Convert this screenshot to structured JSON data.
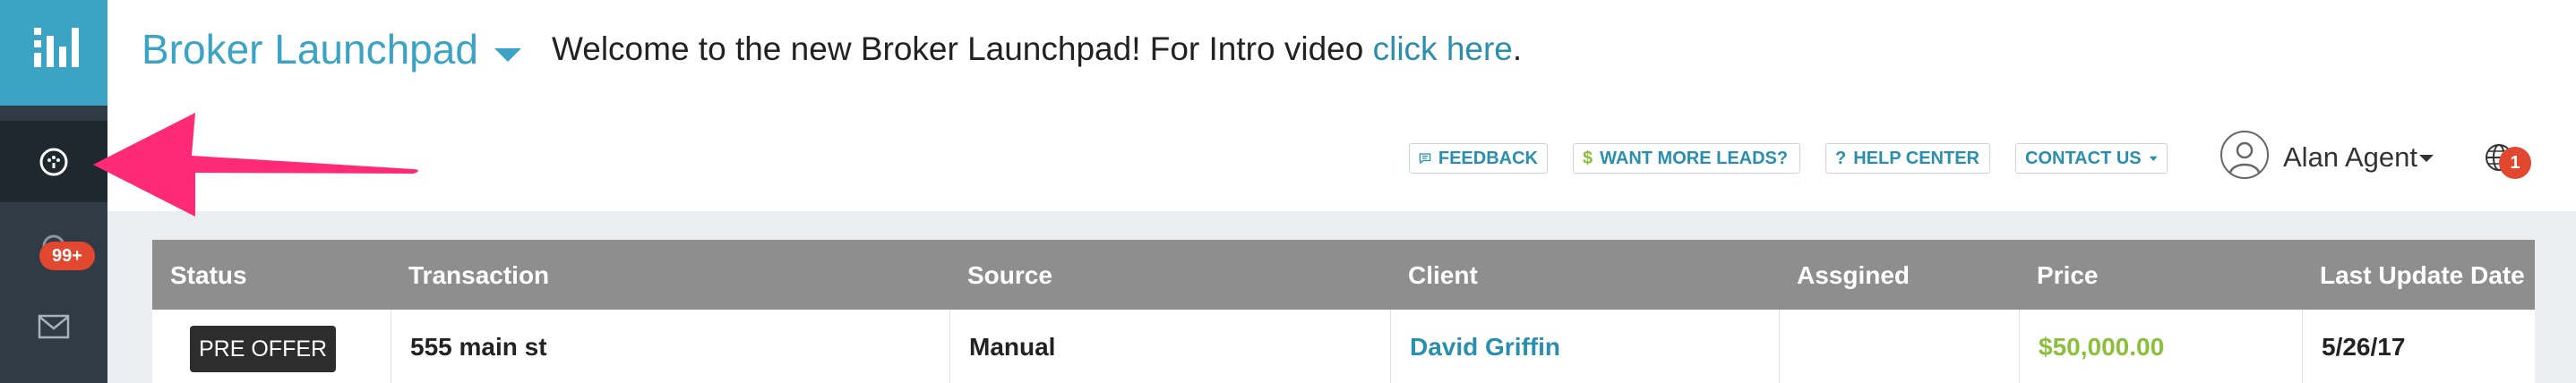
{
  "app": {
    "title": "Broker Launchpad"
  },
  "banner": {
    "welcome_text": "Welcome to the new Broker Launchpad! For Intro video ",
    "link_text": "click here",
    "trailing": "."
  },
  "sidebar": {
    "badge_count": "99+"
  },
  "toolbar": {
    "feedback": "FEEDBACK",
    "more_leads": "WANT MORE LEADS?",
    "more_leads_icon": "$",
    "help_center": "HELP CENTER",
    "help_icon": "?",
    "contact_us": "CONTACT US"
  },
  "user": {
    "name": "Alan Agent",
    "notifications": "1"
  },
  "table": {
    "headers": [
      "Status",
      "Transaction",
      "Source",
      "Client",
      "Assgined",
      "Price",
      "Last Update Date"
    ],
    "rows": [
      {
        "status": "PRE OFFER",
        "transaction": "555 main st",
        "source": "Manual",
        "client": "David Griffin",
        "assigned": "",
        "price": "$50,000.00",
        "last_update": "5/26/17"
      }
    ]
  },
  "colors": {
    "accent": "#3ba3c3",
    "sidebar": "#2f3b45",
    "badge": "#e2472f",
    "price": "#8bbf3c",
    "annotation_arrow": "#ff2a75"
  }
}
